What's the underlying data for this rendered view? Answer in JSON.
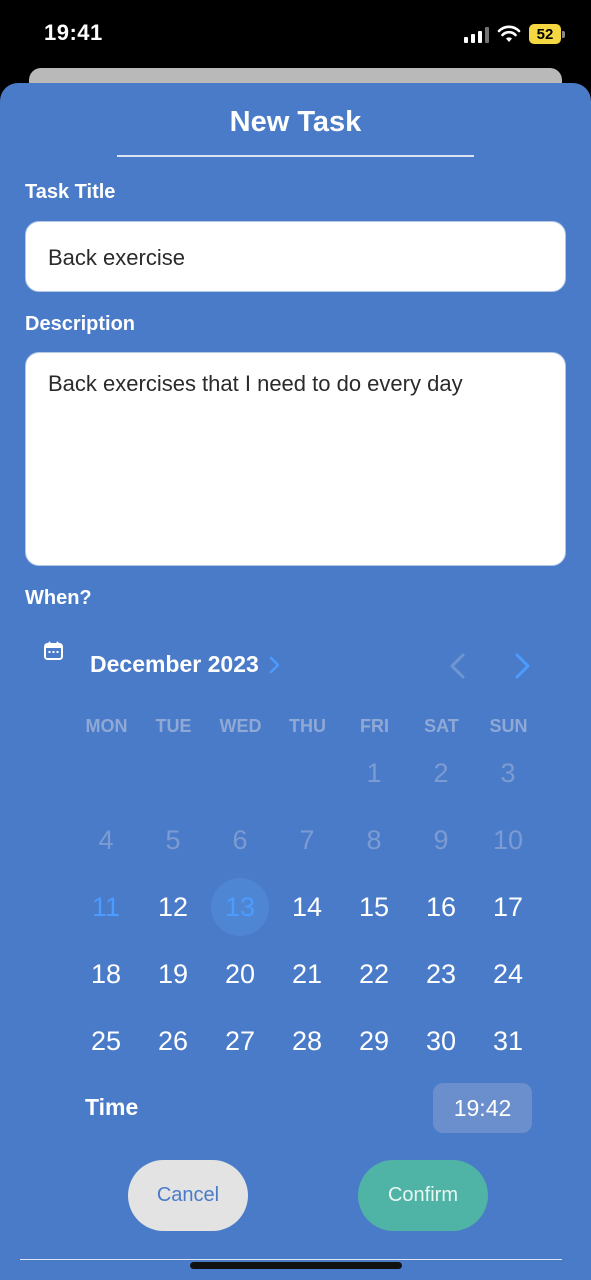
{
  "status_bar": {
    "time": "19:41",
    "battery": "52"
  },
  "form": {
    "title": "New Task",
    "task_title_label": "Task Title",
    "task_title_value": "Back exercise",
    "description_label": "Description",
    "description_value": "Back exercises that I need to do every day",
    "when_label": "When?"
  },
  "calendar": {
    "month_label": "December 2023",
    "weekdays": [
      "MON",
      "TUE",
      "WED",
      "THU",
      "FRI",
      "SAT",
      "SUN"
    ],
    "disabled_days": [
      "1",
      "2",
      "3",
      "4",
      "5",
      "6",
      "7",
      "8",
      "9",
      "10"
    ],
    "today_day": "11",
    "selected_day": "13",
    "days": [
      "11",
      "12",
      "13",
      "14",
      "15",
      "16",
      "17",
      "18",
      "19",
      "20",
      "21",
      "22",
      "23",
      "24",
      "25",
      "26",
      "27",
      "28",
      "29",
      "30",
      "31"
    ]
  },
  "time": {
    "label": "Time",
    "value": "19:42"
  },
  "buttons": {
    "cancel": "Cancel",
    "confirm": "Confirm"
  },
  "colors": {
    "sheet": "#4a7bc8",
    "accent": "#4c9bff",
    "confirm": "#4fb3a6",
    "cancel": "#e3e3e3"
  },
  "icons": [
    "calendar-icon",
    "chevron-right-icon",
    "chevron-left-icon",
    "wifi-icon",
    "signal-icon",
    "battery-icon"
  ]
}
